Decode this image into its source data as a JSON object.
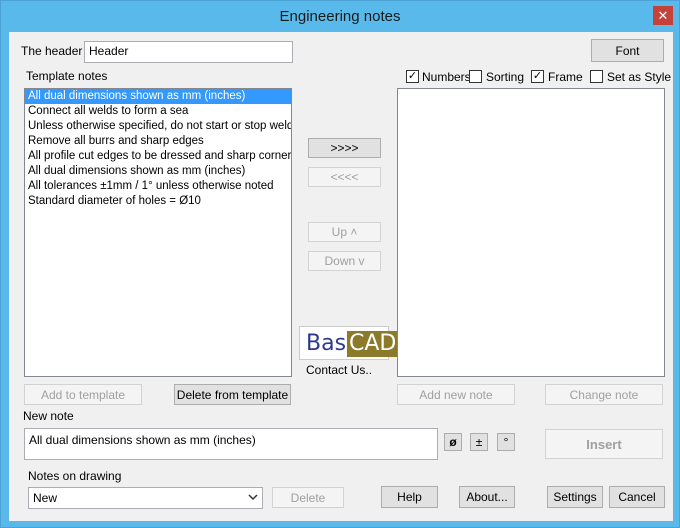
{
  "window": {
    "title": "Engineering notes",
    "close_glyph": "✕"
  },
  "header": {
    "label": "The header",
    "value": "Header",
    "font_button": "Font"
  },
  "template": {
    "label": "Template notes",
    "items": [
      "All dual dimensions shown as mm (inches)",
      "Connect all welds to form a sea",
      "Unless otherwise specified, do not start or stop weld in",
      "Remove all burrs and sharp edges",
      "All profile cut edges to be dressed and sharp corners r",
      "All dual dimensions shown as mm (inches)",
      "All tolerances ±1mm / 1° unless otherwise noted",
      "Standard diameter of holes = Ø10"
    ],
    "add_button": "Add to template",
    "delete_button": "Delete from template"
  },
  "options": {
    "numbers": {
      "label": "Numbers",
      "checked": true
    },
    "sorting": {
      "label": "Sorting",
      "checked": false
    },
    "frame": {
      "label": "Frame",
      "checked": true
    },
    "set_as_style": {
      "label": "Set as Style",
      "checked": false
    },
    "check_glyph": "✓"
  },
  "transfer": {
    "move_right": ">>>>",
    "move_left": "<<<<",
    "up": "Up ˄",
    "down": "Down v"
  },
  "logo": {
    "part1": "Basi",
    "part2": "CAD",
    "contact": "Contact Us.."
  },
  "notes_panel": {
    "add_button": "Add new note",
    "change_button": "Change note"
  },
  "new_note": {
    "label": "New note",
    "value": "All dual dimensions shown as mm (inches)",
    "sym_diameter": "ø",
    "sym_plusminus": "±",
    "sym_degree": "°",
    "insert_button": "Insert"
  },
  "drawing": {
    "label": "Notes on drawing",
    "selected": "New",
    "delete_button": "Delete"
  },
  "footer": {
    "help": "Help",
    "about": "About...",
    "settings": "Settings",
    "cancel": "Cancel"
  }
}
